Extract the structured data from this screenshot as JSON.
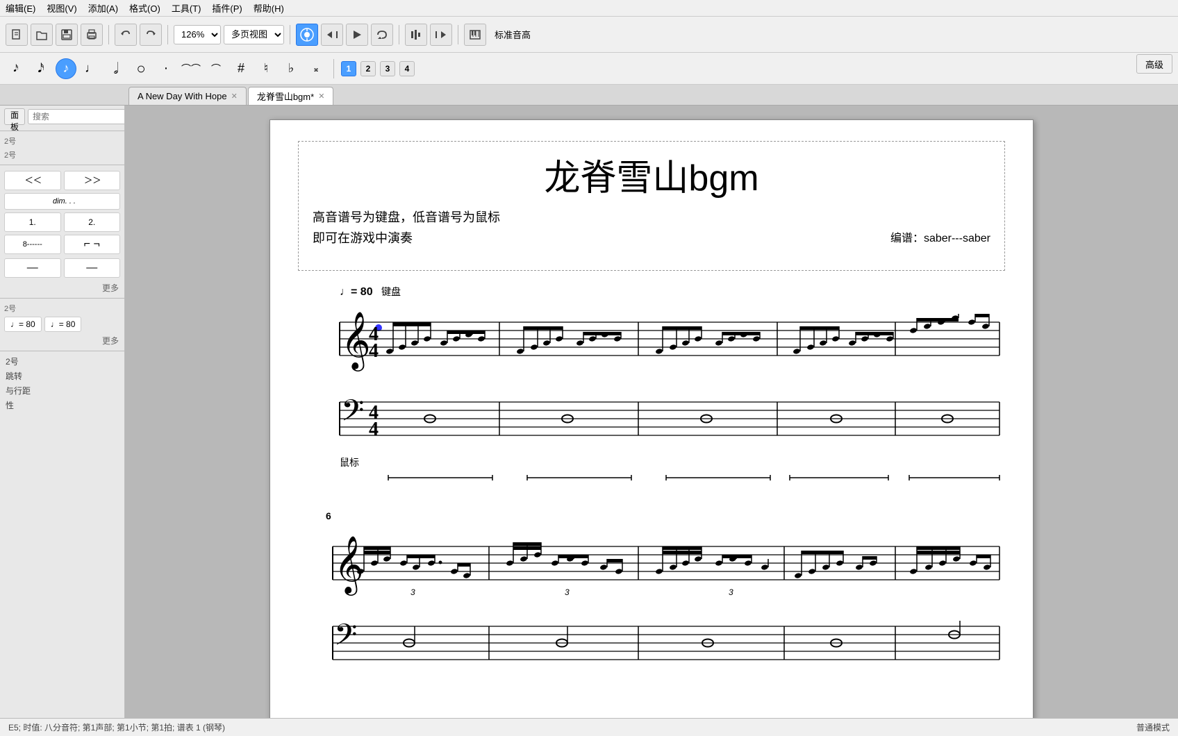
{
  "menubar": {
    "items": [
      "编辑(E)",
      "视图(V)",
      "添加(A)",
      "格式(O)",
      "工具(T)",
      "插件(P)",
      "帮助(H)"
    ]
  },
  "toolbar": {
    "zoom_value": "126%",
    "view_mode": "多页视图",
    "std_pitch_label": "标准音高",
    "advanced_label": "高级"
  },
  "note_toolbar": {
    "voices": [
      "1",
      "2",
      "3",
      "4"
    ]
  },
  "tabs": [
    {
      "label": "A New Day With Hope",
      "closable": true,
      "active": false
    },
    {
      "label": "龙脊雪山bgm*",
      "closable": true,
      "active": true
    }
  ],
  "left_panel": {
    "panel_btn_label": "面板",
    "search_placeholder": "搜索",
    "section1_label": "2号",
    "section2_label": "2号",
    "art_items": [
      "≤",
      "≥",
      "dim. . .",
      "1.",
      "2.",
      ""
    ],
    "more_label": "更多",
    "section3_label": "2号",
    "tempo_items": [
      {
        "label": "♩= 80"
      },
      {
        "label": "♩= 80"
      }
    ],
    "more2_label": "更多",
    "prop_items": [
      "2号",
      "跳转",
      "与行距",
      "性"
    ]
  },
  "score": {
    "title": "龙脊雪山bgm",
    "subtitle1": "高音谱号为键盘，低音谱号为鼠标",
    "subtitle2": "即可在游戏中演奏",
    "arranger": "编谱：saber---saber",
    "tempo": "♩= 80",
    "keyboard_label": "键盘",
    "mouse_label": "鼠标",
    "measure_number_6": "6"
  },
  "statusbar": {
    "left_text": "E5; 时值: 八分音符; 第1声部; 第1小节; 第1拍; 谱表 1 (钢琴)",
    "right_text": "普通模式"
  }
}
